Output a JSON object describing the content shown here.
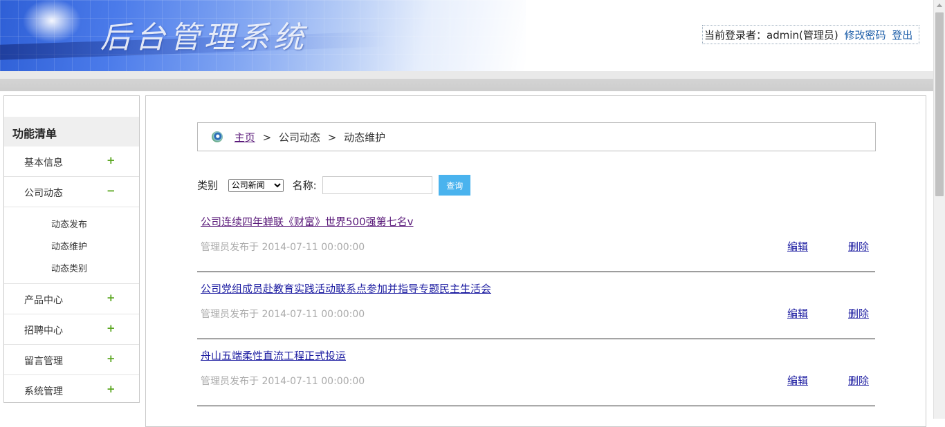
{
  "header": {
    "system_title": "后台管理系统",
    "login_prefix": "当前登录者：admin(管理员)",
    "change_password": "修改密码",
    "logout": "登出"
  },
  "sidebar": {
    "title": "功能清单",
    "items": [
      {
        "label": "基本信息",
        "toggle": "+"
      },
      {
        "label": "公司动态",
        "toggle": "−",
        "children": [
          "动态发布",
          "动态维护",
          "动态类别"
        ]
      },
      {
        "label": "产品中心",
        "toggle": "+"
      },
      {
        "label": "招聘中心",
        "toggle": "+"
      },
      {
        "label": "留言管理",
        "toggle": "+"
      },
      {
        "label": "系统管理",
        "toggle": "+"
      }
    ]
  },
  "breadcrumb": {
    "home": "主页",
    "sep": ">",
    "level1": "公司动态",
    "level2": "动态维护"
  },
  "filter": {
    "category_label": "类别",
    "category_value": "公司新闻",
    "name_label": "名称:",
    "name_value": "",
    "query_button": "查询"
  },
  "news": [
    {
      "title": "公司连续四年蝉联《财富》世界500强第七名v",
      "meta": "管理员发布于 2014-07-11 00:00:00",
      "edit": "编辑",
      "delete": "删除"
    },
    {
      "title": "公司党组成员赴教育实践活动联系点参加并指导专题民主生活会",
      "meta": "管理员发布于 2014-07-11 00:00:00",
      "edit": "编辑",
      "delete": "删除"
    },
    {
      "title": "舟山五端柔性直流工程正式投运",
      "meta": "管理员发布于 2014-07-11 00:00:00",
      "edit": "编辑",
      "delete": "删除"
    }
  ],
  "colors": {
    "accent_green": "#5aa620",
    "query_button_bg": "#4ab3ee",
    "link_blue": "#1a1aa0"
  }
}
